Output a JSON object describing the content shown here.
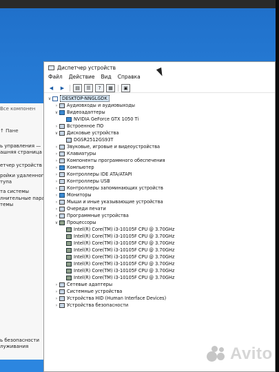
{
  "device_manager": {
    "title": "Диспетчер устройств",
    "menu": [
      "Файл",
      "Действие",
      "Вид",
      "Справка"
    ],
    "root": "DESKTOP-NNGLGDK",
    "tree": [
      {
        "label": "Аудиовходы и аудиовыходы",
        "expanded": false,
        "level": 1
      },
      {
        "label": "Видеоадаптеры",
        "expanded": true,
        "level": 1,
        "icon": "monitor"
      },
      {
        "label": "NVIDIA GeForce GTX 1050 Ti",
        "level": 2,
        "icon": "monitor"
      },
      {
        "label": "Встроенное ПО",
        "expanded": false,
        "level": 1
      },
      {
        "label": "Дисковые устройства",
        "expanded": true,
        "level": 1
      },
      {
        "label": "DGSR2512GS93T",
        "level": 2
      },
      {
        "label": "Звуковые, игровые и видеоустройства",
        "expanded": false,
        "level": 1
      },
      {
        "label": "Клавиатуры",
        "expanded": false,
        "level": 1
      },
      {
        "label": "Компоненты программного обеспечения",
        "expanded": false,
        "level": 1
      },
      {
        "label": "Компьютер",
        "expanded": false,
        "level": 1,
        "icon": "monitor"
      },
      {
        "label": "Контроллеры IDE ATA/ATAPI",
        "expanded": false,
        "level": 1
      },
      {
        "label": "Контроллеры USB",
        "expanded": false,
        "level": 1
      },
      {
        "label": "Контроллеры запоминающих устройств",
        "expanded": false,
        "level": 1
      },
      {
        "label": "Мониторы",
        "expanded": false,
        "level": 1,
        "icon": "monitor"
      },
      {
        "label": "Мыши и иные указывающие устройства",
        "expanded": false,
        "level": 1
      },
      {
        "label": "Очереди печати",
        "expanded": false,
        "level": 1
      },
      {
        "label": "Программные устройства",
        "expanded": false,
        "level": 1
      },
      {
        "label": "Процессоры",
        "expanded": true,
        "level": 1,
        "icon": "cpu"
      },
      {
        "label": "Intel(R) Core(TM) i3-10105F CPU @ 3.70GHz",
        "level": 2,
        "icon": "cpu"
      },
      {
        "label": "Intel(R) Core(TM) i3-10105F CPU @ 3.70GHz",
        "level": 2,
        "icon": "cpu"
      },
      {
        "label": "Intel(R) Core(TM) i3-10105F CPU @ 3.70GHz",
        "level": 2,
        "icon": "cpu"
      },
      {
        "label": "Intel(R) Core(TM) i3-10105F CPU @ 3.70GHz",
        "level": 2,
        "icon": "cpu"
      },
      {
        "label": "Intel(R) Core(TM) i3-10105F CPU @ 3.70GHz",
        "level": 2,
        "icon": "cpu"
      },
      {
        "label": "Intel(R) Core(TM) i3-10105F CPU @ 3.70GHz",
        "level": 2,
        "icon": "cpu"
      },
      {
        "label": "Intel(R) Core(TM) i3-10105F CPU @ 3.70GHz",
        "level": 2,
        "icon": "cpu"
      },
      {
        "label": "Intel(R) Core(TM) i3-10105F CPU @ 3.70GHz",
        "level": 2,
        "icon": "cpu"
      },
      {
        "label": "Сетевые адаптеры",
        "expanded": false,
        "level": 1
      },
      {
        "label": "Системные устройства",
        "expanded": false,
        "level": 1
      },
      {
        "label": "Устройства HID (Human Interface Devices)",
        "expanded": false,
        "level": 1
      },
      {
        "label": "Устройства безопасности",
        "expanded": false,
        "level": 1
      }
    ]
  },
  "control_panel": {
    "title": "Все компонен",
    "nav": "Пане",
    "items": [
      "ь управления —",
      "ашняя страница",
      "етчер устройств",
      "ройки удаленного",
      "тупа",
      "та системы",
      "лнительные парамет",
      "темы"
    ],
    "bottom_items": [
      "ь безопасности",
      "луживания"
    ]
  },
  "watermark": {
    "text": "Avito"
  }
}
